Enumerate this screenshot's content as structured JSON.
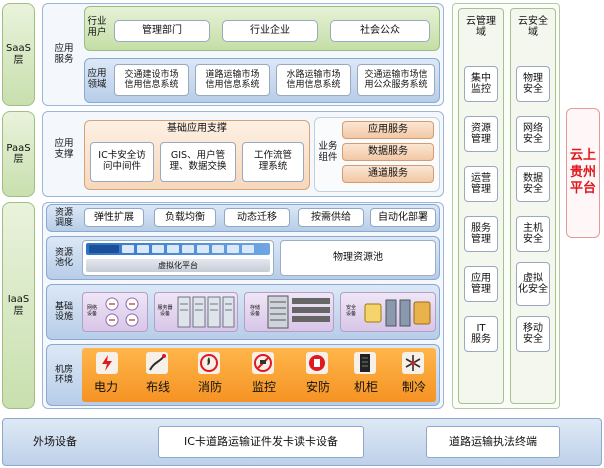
{
  "layers": {
    "saas": "SaaS\n层",
    "paas": "PaaS\n层",
    "iaas": "IaaS\n层"
  },
  "saas": {
    "section_label": "应用\n服务",
    "industry_label": "行业\n用户",
    "industry_items": [
      "管理部门",
      "行业企业",
      "社会公众"
    ],
    "domain_label": "应用\n领域",
    "domain_items": [
      "交通建设市场\n信用信息系统",
      "道路运输市场\n信用信息系统",
      "水路运输市场\n信用信息系统",
      "交通运输市场信\n用公众服务系统"
    ]
  },
  "paas": {
    "section_label": "应用\n支撑",
    "base_title": "基础应用支撑",
    "base_items": [
      "IC卡安全访\n问中间件",
      "GIS、用户管\n理、数据交换",
      "工作流管\n理系统"
    ],
    "biz_label": "业务\n组件",
    "biz_items": [
      "应用服务",
      "数据服务",
      "通道服务"
    ]
  },
  "iaas": {
    "scheduling_label": "资源\n调度",
    "scheduling_items": [
      "弹性扩展",
      "负载均衡",
      "动态迁移",
      "按需供给",
      "自动化部署"
    ],
    "pool_label": "资源\n池化",
    "virtual_platform": "虚拟化平台",
    "physical_pool": "物理资源池",
    "infra_label": "基础\n设施",
    "infra_groups": [
      "网络\n设备",
      "服务器\n设备",
      "存储\n设备",
      "安全\n设备"
    ],
    "room_label": "机房\n环境",
    "room_items": [
      "电力",
      "布线",
      "消防",
      "监控",
      "安防",
      "机柜",
      "制冷"
    ]
  },
  "cloud_mgmt": {
    "title": "云管理\n域",
    "items": [
      "集中\n监控",
      "资源\n管理",
      "运营\n管理",
      "服务\n管理",
      "应用\n管理",
      "IT\n服务"
    ]
  },
  "cloud_sec": {
    "title": "云安全\n域",
    "items": [
      "物理\n安全",
      "网络\n安全",
      "数据\n安全",
      "主机\n安全",
      "虚拟\n化安全",
      "移动\n安全"
    ]
  },
  "platform": {
    "label": "云上\n贵州\n平台"
  },
  "footer": {
    "label": "外场设备",
    "items": [
      "IC卡道路运输证件发卡读卡设备",
      "道路运输执法终端"
    ]
  },
  "colors": {
    "platform_text": "#e0191f",
    "accent_blue": "#1f5fb0",
    "room_icon_bg": "#f7f0e8",
    "room_icon_mark": "#e0191f"
  }
}
